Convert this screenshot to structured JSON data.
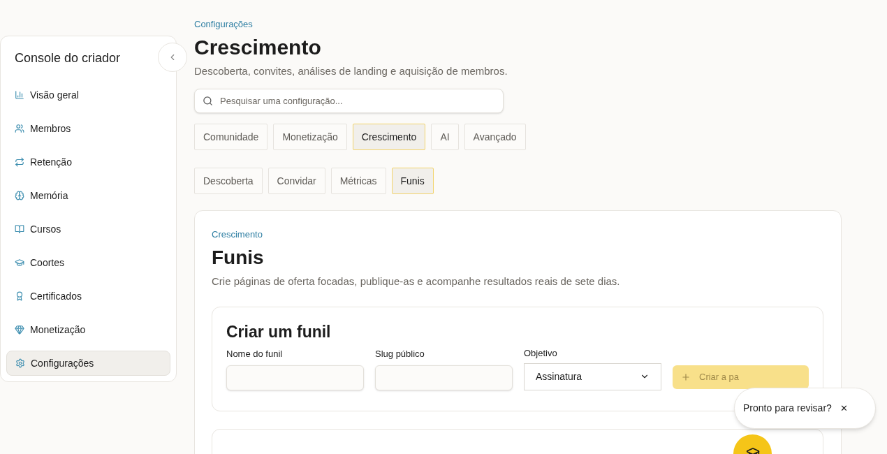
{
  "sidebar": {
    "title": "Console do criador",
    "items": [
      {
        "label": "Visão geral",
        "selected": false
      },
      {
        "label": "Membros",
        "selected": false
      },
      {
        "label": "Retenção",
        "selected": false
      },
      {
        "label": "Memória",
        "selected": false
      },
      {
        "label": "Cursos",
        "selected": false
      },
      {
        "label": "Coortes",
        "selected": false
      },
      {
        "label": "Certificados",
        "selected": false
      },
      {
        "label": "Monetização",
        "selected": false
      },
      {
        "label": "Configurações",
        "selected": true
      }
    ]
  },
  "header": {
    "breadcrumb": "Configurações",
    "title": "Crescimento",
    "subtitle": "Descoberta, convites, análises de landing e aquisição de membros."
  },
  "search": {
    "placeholder": "Pesquisar uma configuração..."
  },
  "tabs": [
    {
      "label": "Comunidade",
      "selected": false
    },
    {
      "label": "Monetização",
      "selected": false
    },
    {
      "label": "Crescimento",
      "selected": true
    },
    {
      "label": "AI",
      "selected": false
    },
    {
      "label": "Avançado",
      "selected": false
    }
  ],
  "subtabs": [
    {
      "label": "Descoberta",
      "selected": false
    },
    {
      "label": "Convidar",
      "selected": false
    },
    {
      "label": "Métricas",
      "selected": false
    },
    {
      "label": "Funis",
      "selected": true
    }
  ],
  "section": {
    "eyebrow": "Crescimento",
    "title": "Funis",
    "description": "Crie páginas de oferta focadas, publique-as e acompanhe resultados reais de sete dias."
  },
  "create_form": {
    "title": "Criar um funil",
    "fields": [
      {
        "label": "Nome do funil",
        "kind": "text"
      },
      {
        "label": "Slug público",
        "kind": "text"
      },
      {
        "label": "Objetivo",
        "kind": "select",
        "value": "Assinatura"
      }
    ],
    "button": {
      "label": "Criar a pa",
      "disabled": true
    }
  },
  "popup": {
    "text": "Pronto para revisar?",
    "close": "✕"
  }
}
